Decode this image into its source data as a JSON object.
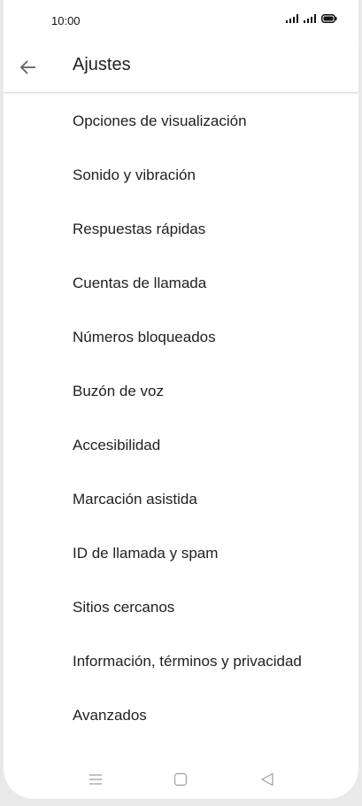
{
  "status_bar": {
    "time": "10:00",
    "icons": [
      "signal-icon",
      "signal-icon",
      "battery-icon"
    ]
  },
  "app_bar": {
    "back_icon": "arrow-left-icon",
    "title": "Ajustes"
  },
  "settings": {
    "items": [
      {
        "label": "Opciones de visualización"
      },
      {
        "label": "Sonido y vibración"
      },
      {
        "label": "Respuestas rápidas"
      },
      {
        "label": "Cuentas de llamada"
      },
      {
        "label": "Números bloqueados"
      },
      {
        "label": "Buzón de voz"
      },
      {
        "label": "Accesibilidad"
      },
      {
        "label": "Marcación asistida"
      },
      {
        "label": "ID de llamada y spam"
      },
      {
        "label": "Sitios cercanos"
      },
      {
        "label": "Información, términos y privacidad"
      },
      {
        "label": "Avanzados"
      }
    ]
  },
  "nav_bar": {
    "icons": [
      "menu-icon",
      "home-icon",
      "back-triangle-icon"
    ]
  },
  "colors": {
    "text_primary": "#202124",
    "icon_gray": "#5f6368",
    "nav_gray": "#9e9e9e"
  }
}
